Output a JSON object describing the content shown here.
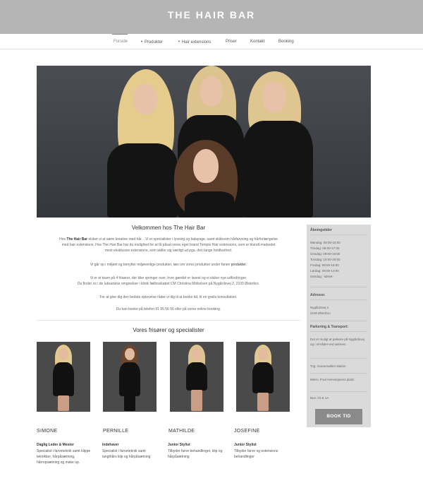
{
  "header": {
    "brand": "THE HAIR BAR"
  },
  "nav": {
    "items": [
      {
        "label": "Forside"
      },
      {
        "label": "Produkter"
      },
      {
        "label": "Hair extensions"
      },
      {
        "label": "Priser"
      },
      {
        "label": "Kontakt"
      },
      {
        "label": "Booking"
      }
    ]
  },
  "welcome": {
    "title": "Velkommen hos The Hair Bar",
    "p1": {
      "pre": "Hos ",
      "brand": "The Hair Bar",
      "post1": " elsker vi at være kreative med hår. . Vi er specialister i lysning og balayage, samt skånsom hårfarvning og hårforlængelse",
      "line2": "med hair extensions. Hos The Hair Bar har du mulighed for at få påsat vores eget brand Temple Hair extensions, som er blandt markedet",
      "line3": "mest eksklusive extensions, som skiller sig særligt ud pga. den lange holdbarhed."
    },
    "p2": {
      "pre": "Vi går op i miljøet og benytter miljøvenlige produkter, læs om vores produkter under fanen ",
      "link": "produkter",
      "post": "."
    },
    "p3": {
      "line1": "Vi er et team på 4 frisører, der ikke springer over, hvor gærdet er lavest og vi elsker nye udfordringer.",
      "line2": "Du finder os i de luksuriøse omgivelser i klinik fællesskabet CM Christina Mikkelsen på Nygårdsvej 2, 2100 Østerbro."
    },
    "p4": "For at give dig den bedste oplevelse råder vi dig til at booke tid, til en gratis konsultation.",
    "p5": "Du kan booke på telefon 91 95 56 56 eller på vores online booking."
  },
  "staff": {
    "title": "Vores frisører og specialister",
    "members": [
      {
        "name": "SIMONE",
        "role": "Daglig Leder & Mester",
        "desc": "Specialist i farveteknik samt klippe teknikker, hårpåsætning, hårropsætning og make up."
      },
      {
        "name": "PERNILLE",
        "role": "Indehaver",
        "desc": "Specialist i farveteknik samt langthårs klip og hårpåsætning"
      },
      {
        "name": "MATHILDE",
        "role": "Junior Stylist",
        "desc": "Tilbyder farve behandlinger, klip og hårpåsætning"
      },
      {
        "name": "JOSEFINE",
        "role": "Junior Stylist",
        "desc": "Tilbyder farve og extensions behandlinger"
      }
    ]
  },
  "sidebar": {
    "hours_heading": "Åbningstider",
    "hours": [
      "Mandag: 09:00-15:00",
      "Tirsdag: 09:00-17:30",
      "Onsdag: 09:00-19:00",
      "Torsdag: 10:00-20:00",
      "Fredag: 08:00-16:00",
      "Lørdag: 09:00-13:00",
      "Søndag: -lukket-"
    ],
    "address_heading": "Adresse:",
    "address": [
      "Nygårdsvej 2",
      "2100 Østerbro"
    ],
    "transport_heading": "Parkering & Transport:",
    "parking": "Det er muligt at parkere på Nygårdsvej og i området ved salonen.",
    "train": "Tog: Svanemøllen station",
    "metro": "Metro: Poul Henningsens plads",
    "bus": "Bus: 23 & 1A",
    "book_button": "BOOK TID"
  },
  "colors": {
    "topbar": "#b5b5b5",
    "sidebar": "#dadada",
    "button": "#8a8a8a"
  }
}
